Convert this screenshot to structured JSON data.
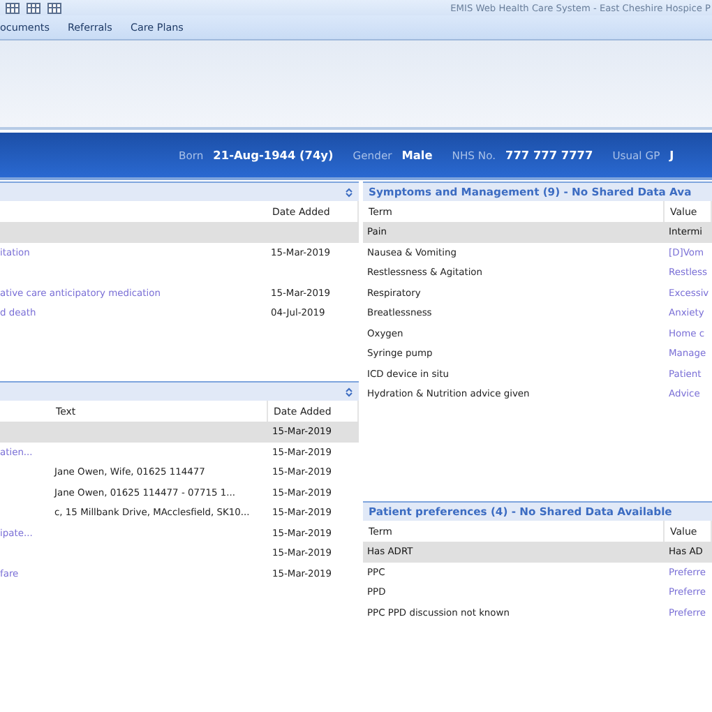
{
  "window": {
    "title": "EMIS Web Health Care System - East Cheshire Hospice P"
  },
  "menu": [
    "ocuments",
    "Referrals",
    "Care Plans"
  ],
  "banner": [
    {
      "label": "Born",
      "value": "21-Aug-1944 (74y)"
    },
    {
      "label": "Gender",
      "value": "Male"
    },
    {
      "label": "NHS No.",
      "value": "777 777 7777"
    },
    {
      "label": "Usual GP",
      "value": "J"
    }
  ],
  "left_panel_1": {
    "columns": [
      "",
      "Date Added"
    ],
    "rows": [
      {
        "selected": true,
        "cells": [
          "",
          ""
        ]
      },
      {
        "selected": false,
        "cells": [
          "itation",
          "15-Mar-2019"
        ]
      },
      {
        "selected": false,
        "cells": [
          "",
          ""
        ]
      },
      {
        "selected": false,
        "cells": [
          "ative care anticipatory medication",
          "15-Mar-2019"
        ]
      },
      {
        "selected": false,
        "cells": [
          "d death",
          "04-Jul-2019"
        ]
      }
    ]
  },
  "left_panel_2": {
    "columns": [
      "",
      "Text",
      "Date Added"
    ],
    "rows": [
      {
        "selected": true,
        "cells": [
          "",
          "",
          "15-Mar-2019"
        ]
      },
      {
        "selected": false,
        "cells": [
          "atien...",
          "",
          "15-Mar-2019"
        ]
      },
      {
        "selected": false,
        "cells": [
          "",
          "Jane Owen, Wife, 01625 114477",
          "15-Mar-2019"
        ]
      },
      {
        "selected": false,
        "cells": [
          "",
          "Jane Owen, 01625 114477 - 07715 1...",
          "15-Mar-2019"
        ]
      },
      {
        "selected": false,
        "cells": [
          "",
          "c, 15 Millbank Drive, MAcclesfield, SK10...",
          "15-Mar-2019"
        ]
      },
      {
        "selected": false,
        "cells": [
          "ipate...",
          "",
          "15-Mar-2019"
        ]
      },
      {
        "selected": false,
        "cells": [
          "",
          "",
          "15-Mar-2019"
        ]
      },
      {
        "selected": false,
        "cells": [
          "fare",
          "",
          "15-Mar-2019"
        ]
      }
    ]
  },
  "symptoms": {
    "title": "Symptoms and Management (9) - No Shared Data Ava",
    "columns": [
      "Term",
      "Value"
    ],
    "rows": [
      {
        "selected": true,
        "cells": [
          "Pain",
          "Intermi"
        ]
      },
      {
        "selected": false,
        "cells": [
          "Nausea & Vomiting",
          "[D]Vom"
        ]
      },
      {
        "selected": false,
        "cells": [
          "Restlessness & Agitation",
          "Restless"
        ]
      },
      {
        "selected": false,
        "cells": [
          "Respiratory",
          "Excessiv"
        ]
      },
      {
        "selected": false,
        "cells": [
          "Breatlessness",
          "Anxiety"
        ]
      },
      {
        "selected": false,
        "cells": [
          "Oxygen",
          "Home c"
        ]
      },
      {
        "selected": false,
        "cells": [
          "Syringe pump",
          "Manage"
        ]
      },
      {
        "selected": false,
        "cells": [
          "ICD device in situ",
          "Patient"
        ]
      },
      {
        "selected": false,
        "cells": [
          "Hydration & Nutrition advice given",
          "Advice"
        ]
      }
    ]
  },
  "preferences": {
    "title": "Patient preferences (4) - No Shared Data Available",
    "columns": [
      "Term",
      "Value"
    ],
    "rows": [
      {
        "selected": true,
        "cells": [
          "Has ADRT",
          "Has AD"
        ]
      },
      {
        "selected": false,
        "cells": [
          "PPC",
          "Preferre"
        ]
      },
      {
        "selected": false,
        "cells": [
          "PPD",
          "Preferre"
        ]
      },
      {
        "selected": false,
        "cells": [
          "PPC PPD discussion not known",
          "Preferre"
        ]
      }
    ]
  }
}
